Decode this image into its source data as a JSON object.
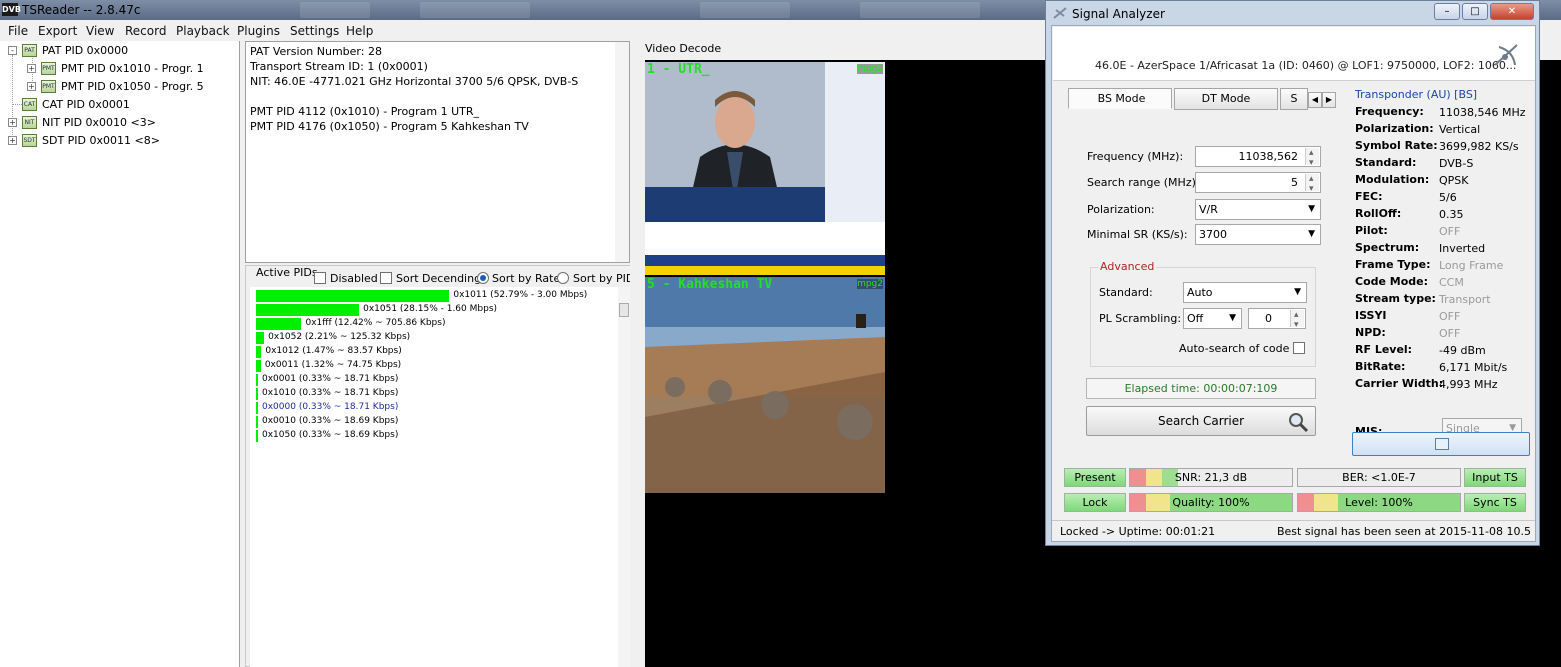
{
  "window": {
    "title": "TSReader -- 2.8.47c",
    "icon_text": "DVB"
  },
  "menu": [
    "File",
    "Export",
    "View",
    "Record",
    "Playback",
    "Plugins",
    "Settings",
    "Help"
  ],
  "tree": [
    {
      "label": "PAT PID 0x0000",
      "icon": "PAT",
      "toggle": "-"
    },
    {
      "label": "PMT PID 0x1010 - Progr. 1",
      "icon": "PMT",
      "toggle": "+"
    },
    {
      "label": "PMT PID 0x1050 - Progr. 5",
      "icon": "PMT",
      "toggle": "+"
    },
    {
      "label": "CAT PID 0x0001",
      "icon": "CAT",
      "toggle": ""
    },
    {
      "label": "NIT PID 0x0010 <3>",
      "icon": "NIT",
      "toggle": "+"
    },
    {
      "label": "SDT PID 0x0011 <8>",
      "icon": "SDT",
      "toggle": "+"
    }
  ],
  "info_lines": [
    "PAT Version Number: 28",
    "Transport Stream ID: 1 (0x0001)",
    "NIT: 46.0E -4771.021 GHz Horizontal  3700 5/6 QPSK, DVB-S",
    "",
    "PMT PID 4112 (0x1010) - Program 1 UTR_",
    "PMT PID 4176 (0x1050) - Program 5 Kahkeshan TV"
  ],
  "active_pids": {
    "title": "Active PIDs",
    "options": {
      "disabled": "Disabled",
      "sort_desc": "Sort Decending",
      "sort_rate": "Sort by Rate",
      "sort_pid": "Sort by PID"
    },
    "rows": [
      {
        "text": "0x1011 (52.79% - 3.00 Mbps)",
        "pct": 52.79,
        "highlight": false
      },
      {
        "text": "0x1051 (28.15% - 1.60 Mbps)",
        "pct": 28.15,
        "highlight": false
      },
      {
        "text": "0x1fff (12.42% ~ 705.86 Kbps)",
        "pct": 12.42,
        "highlight": false
      },
      {
        "text": "0x1052 (2.21% ~ 125.32 Kbps)",
        "pct": 2.21,
        "highlight": false
      },
      {
        "text": "0x1012 (1.47% ~ 83.57 Kbps)",
        "pct": 1.47,
        "highlight": false
      },
      {
        "text": "0x0011 (1.32% ~ 74.75 Kbps)",
        "pct": 1.32,
        "highlight": false
      },
      {
        "text": "0x0001 (0.33% ~ 18.71 Kbps)",
        "pct": 0.33,
        "highlight": false
      },
      {
        "text": "0x1010 (0.33% ~ 18.71 Kbps)",
        "pct": 0.33,
        "highlight": false
      },
      {
        "text": "0x0000 (0.33% ~ 18.71 Kbps)",
        "pct": 0.33,
        "highlight": true
      },
      {
        "text": "0x0010 (0.33% ~ 18.69 Kbps)",
        "pct": 0.33,
        "highlight": false
      },
      {
        "text": "0x1050 (0.33% ~ 18.69 Kbps)",
        "pct": 0.33,
        "highlight": false
      }
    ]
  },
  "video": {
    "label": "Video Decode",
    "ch1": {
      "num": "1 - UTR_",
      "badge": "mpg2"
    },
    "ch2": {
      "num": "5 - Kahkeshan TV",
      "badge": "mpg2"
    }
  },
  "analyzer": {
    "title": "Signal Analyzer",
    "satellite": "46.0E - AzerSpace 1/Africasat 1a (ID: 0460) @ LOF1: 9750000, LOF2: 1060...",
    "tabs": [
      "BS Mode",
      "DT Mode",
      "S"
    ],
    "form": {
      "frequency_label": "Frequency (MHz):",
      "frequency": "11038,562",
      "range_label": "Search range (MHz):",
      "range": "5",
      "pol_label": "Polarization:",
      "pol": "V/R",
      "sr_label": "Minimal SR (KS/s):",
      "sr": "3700"
    },
    "advanced": {
      "title": "Advanced",
      "standard_label": "Standard:",
      "standard": "Auto",
      "pls_label": "PL Scrambling:",
      "pls": "Off",
      "pls_code": "0",
      "autosearch_label": "Auto-search of code"
    },
    "elapsed": "Elapsed time: 00:00:07:109",
    "search_button": "Search Carrier",
    "transponder_title": "Transponder (AU) [BS]",
    "transponder": [
      {
        "k": "Frequency:",
        "v": "11038,546 MHz",
        "dim": false
      },
      {
        "k": "Polarization:",
        "v": "Vertical",
        "dim": false
      },
      {
        "k": "Symbol Rate:",
        "v": "3699,982 KS/s",
        "dim": false
      },
      {
        "k": "Standard:",
        "v": "DVB-S",
        "dim": false
      },
      {
        "k": "Modulation:",
        "v": "QPSK",
        "dim": false
      },
      {
        "k": "FEC:",
        "v": "5/6",
        "dim": false
      },
      {
        "k": "RollOff:",
        "v": "0.35",
        "dim": false
      },
      {
        "k": "Pilot:",
        "v": "OFF",
        "dim": true
      },
      {
        "k": "Spectrum:",
        "v": "Inverted",
        "dim": false
      },
      {
        "k": "Frame Type:",
        "v": "Long Frame",
        "dim": true
      },
      {
        "k": "Code Mode:",
        "v": "CCM",
        "dim": true
      },
      {
        "k": "Stream type:",
        "v": "Transport",
        "dim": true
      },
      {
        "k": "ISSYI",
        "v": "OFF",
        "dim": true
      },
      {
        "k": "NPD:",
        "v": "OFF",
        "dim": true
      },
      {
        "k": "RF Level:",
        "v": "-49 dBm",
        "dim": false
      },
      {
        "k": "BitRate:",
        "v": "6,171 Mbit/s",
        "dim": false
      },
      {
        "k": "Carrier Width:",
        "v": "4,993 MHz",
        "dim": false
      }
    ],
    "mis_label": "MIS:",
    "mis": "Single",
    "indicators": {
      "present": "Present",
      "lock": "Lock",
      "input_ts": "Input TS",
      "sync_ts": "Sync TS",
      "snr": "SNR: 21,3 dB",
      "ber": "BER: <1.0E-7",
      "quality": "Quality: 100%",
      "level": "Level: 100%"
    },
    "status_left": "Locked -> Uptime: 00:01:21",
    "status_right": "Best signal has been seen at 2015-11-08 10.5"
  }
}
